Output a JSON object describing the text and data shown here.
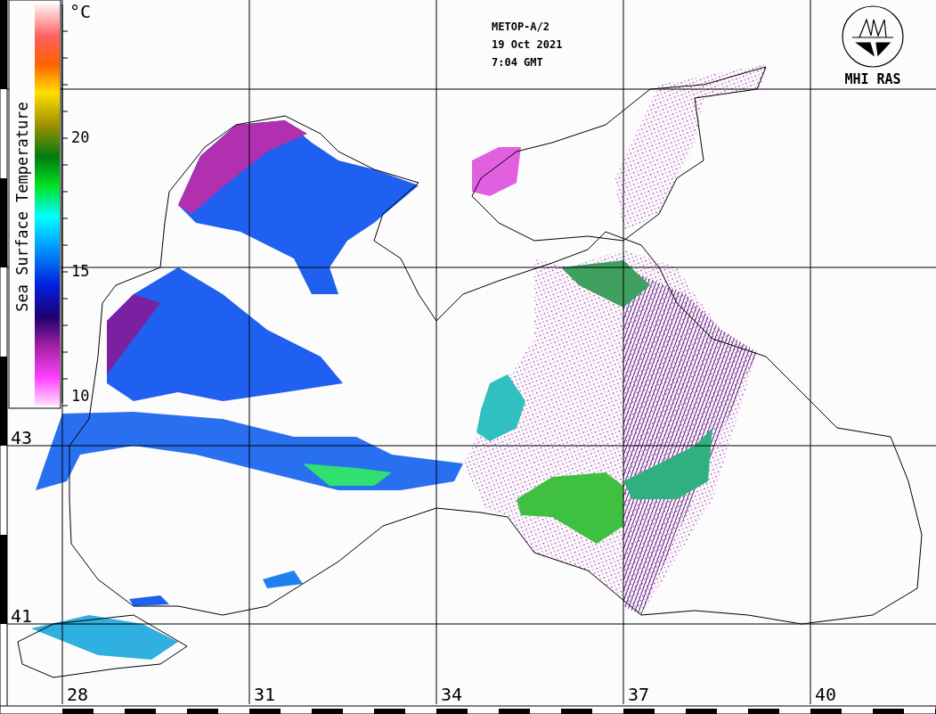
{
  "satellite_info": [
    "METOP-A/2",
    "19 Oct 2021",
    "7:04 GMT"
  ],
  "logo": {
    "text": "MHI RAS"
  },
  "legend": {
    "title": "Sea Surface Temperature",
    "unit": "°C",
    "ticks": [
      "20",
      "15",
      "10"
    ]
  },
  "latitude_labels": [
    "43",
    "41"
  ],
  "longitude_labels": [
    "28",
    "31",
    "34",
    "37",
    "40"
  ]
}
